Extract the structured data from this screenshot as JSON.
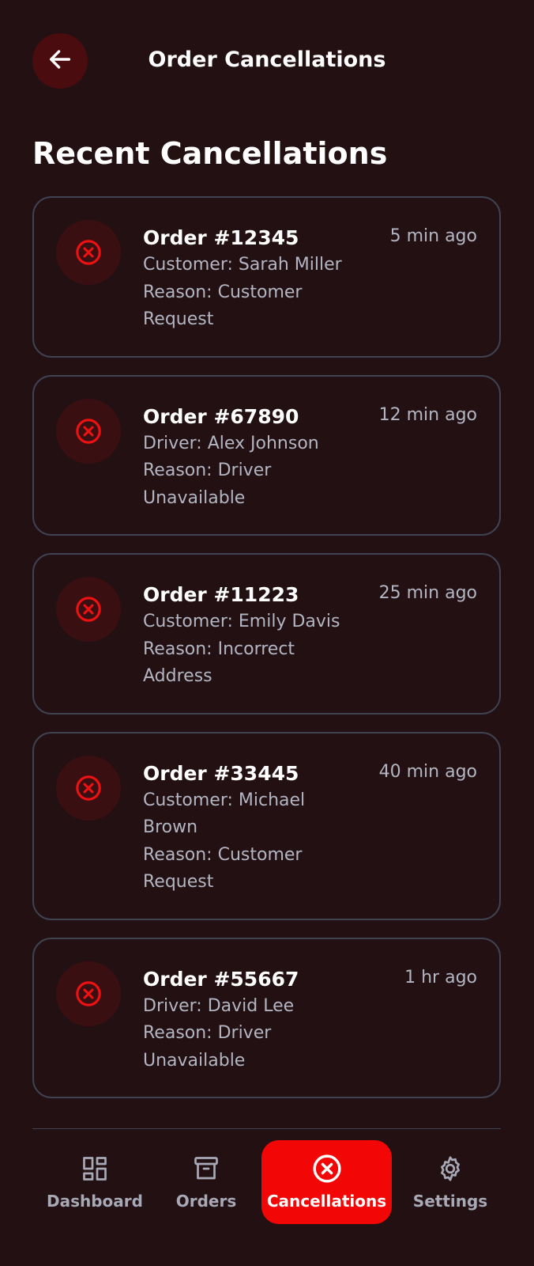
{
  "header": {
    "title": "Order Cancellations"
  },
  "section": {
    "title": "Recent Cancellations"
  },
  "cancellations": [
    {
      "order": "Order #12345",
      "time": "5 min ago",
      "party": "Customer: Sarah Miller",
      "reason": "Reason: Customer Request"
    },
    {
      "order": "Order #67890",
      "time": "12 min ago",
      "party": "Driver: Alex Johnson",
      "reason": "Reason: Driver Unavailable"
    },
    {
      "order": "Order #11223",
      "time": "25 min ago",
      "party": "Customer: Emily Davis",
      "reason": "Reason: Incorrect Address"
    },
    {
      "order": "Order #33445",
      "time": "40 min ago",
      "party": "Customer: Michael Brown",
      "reason": "Reason: Customer Request"
    },
    {
      "order": "Order #55667",
      "time": "1 hr ago",
      "party": "Driver: David Lee",
      "reason": "Reason: Driver Unavailable"
    }
  ],
  "nav": {
    "items": [
      {
        "label": "Dashboard",
        "icon": "dashboard-icon"
      },
      {
        "label": "Orders",
        "icon": "archive-box-icon"
      },
      {
        "label": "Cancellations",
        "icon": "cancel-circle-icon",
        "active": true
      },
      {
        "label": "Settings",
        "icon": "gear-icon"
      }
    ]
  },
  "colors": {
    "background": "#221012",
    "accent": "#f20606",
    "icon_red": "#ee1111",
    "muted_text": "#b3b6c2",
    "border": "#3f4250"
  }
}
